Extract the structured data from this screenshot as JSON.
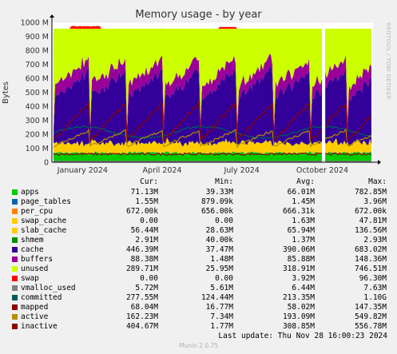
{
  "chart_data": {
    "type": "area",
    "title": "Memory usage - by year",
    "ylabel": "Bytes",
    "side_text": "RRDTOOL / TOBI OETIKER",
    "x_ticks": [
      "January 2024",
      "April 2024",
      "July 2024",
      "October 2024"
    ],
    "x_range": [
      "2023-11-27",
      "2024-11-28"
    ],
    "y_ticks": [
      "0",
      "100 M",
      "200 M",
      "300 M",
      "400 M",
      "500 M",
      "600 M",
      "700 M",
      "800 M",
      "900 M",
      "1000 M"
    ],
    "ylim": [
      0,
      1000
    ],
    "grid": true,
    "legend_position": "bottom",
    "columns": [
      "Cur:",
      "Min:",
      "Avg:",
      "Max:"
    ],
    "series": [
      {
        "name": "apps",
        "color": "#00cc00",
        "kind": "area",
        "cur": "71.13M",
        "min": "39.33M",
        "avg": "66.01M",
        "max": "782.85M"
      },
      {
        "name": "page_tables",
        "color": "#0066b3",
        "kind": "area",
        "cur": "1.55M",
        "min": "879.09k",
        "avg": "1.45M",
        "max": "3.96M"
      },
      {
        "name": "per_cpu",
        "color": "#ff8000",
        "kind": "area",
        "cur": "672.00k",
        "min": "656.00k",
        "avg": "666.31k",
        "max": "672.00k"
      },
      {
        "name": "swap_cache",
        "color": "#ffcc00",
        "kind": "area",
        "cur": "0.00",
        "min": "0.00",
        "avg": "1.63M",
        "max": "47.81M"
      },
      {
        "name": "slab_cache",
        "color": "#ffcc00",
        "kind": "area",
        "cur": "56.44M",
        "min": "28.63M",
        "avg": "65.94M",
        "max": "136.56M"
      },
      {
        "name": "shmem",
        "color": "#008f00",
        "kind": "area",
        "cur": "2.91M",
        "min": "40.00k",
        "avg": "1.37M",
        "max": "2.93M"
      },
      {
        "name": "cache",
        "color": "#330099",
        "kind": "area",
        "cur": "446.39M",
        "min": "37.47M",
        "avg": "390.06M",
        "max": "683.02M"
      },
      {
        "name": "buffers",
        "color": "#990099",
        "kind": "area",
        "cur": "88.38M",
        "min": "1.48M",
        "avg": "85.88M",
        "max": "148.36M"
      },
      {
        "name": "unused",
        "color": "#ccff00",
        "kind": "area",
        "cur": "289.71M",
        "min": "25.95M",
        "avg": "318.91M",
        "max": "746.51M"
      },
      {
        "name": "swap",
        "color": "#ff0000",
        "kind": "area",
        "cur": "0.00",
        "min": "0.00",
        "avg": "3.92M",
        "max": "96.30M"
      },
      {
        "name": "vmalloc_used",
        "color": "#808080",
        "kind": "line",
        "cur": "5.72M",
        "min": "5.61M",
        "avg": "6.44M",
        "max": "7.63M"
      },
      {
        "name": "committed",
        "color": "#005c5c",
        "kind": "line",
        "cur": "277.55M",
        "min": "124.44M",
        "avg": "213.35M",
        "max": "1.10G"
      },
      {
        "name": "mapped",
        "color": "#8f0000",
        "kind": "line",
        "cur": "68.04M",
        "min": "16.77M",
        "avg": "58.02M",
        "max": "147.35M"
      },
      {
        "name": "active",
        "color": "#b38f00",
        "kind": "line",
        "cur": "162.23M",
        "min": "7.34M",
        "avg": "193.09M",
        "max": "549.82M"
      },
      {
        "name": "inactive",
        "color": "#8f0000",
        "kind": "line",
        "cur": "404.67M",
        "min": "1.77M",
        "avg": "308.85M",
        "max": "556.78M"
      }
    ]
  },
  "footer": {
    "last_update": "Last update: Thu Nov 28 16:00:23 2024",
    "munin": "Munin 2.0.75"
  }
}
